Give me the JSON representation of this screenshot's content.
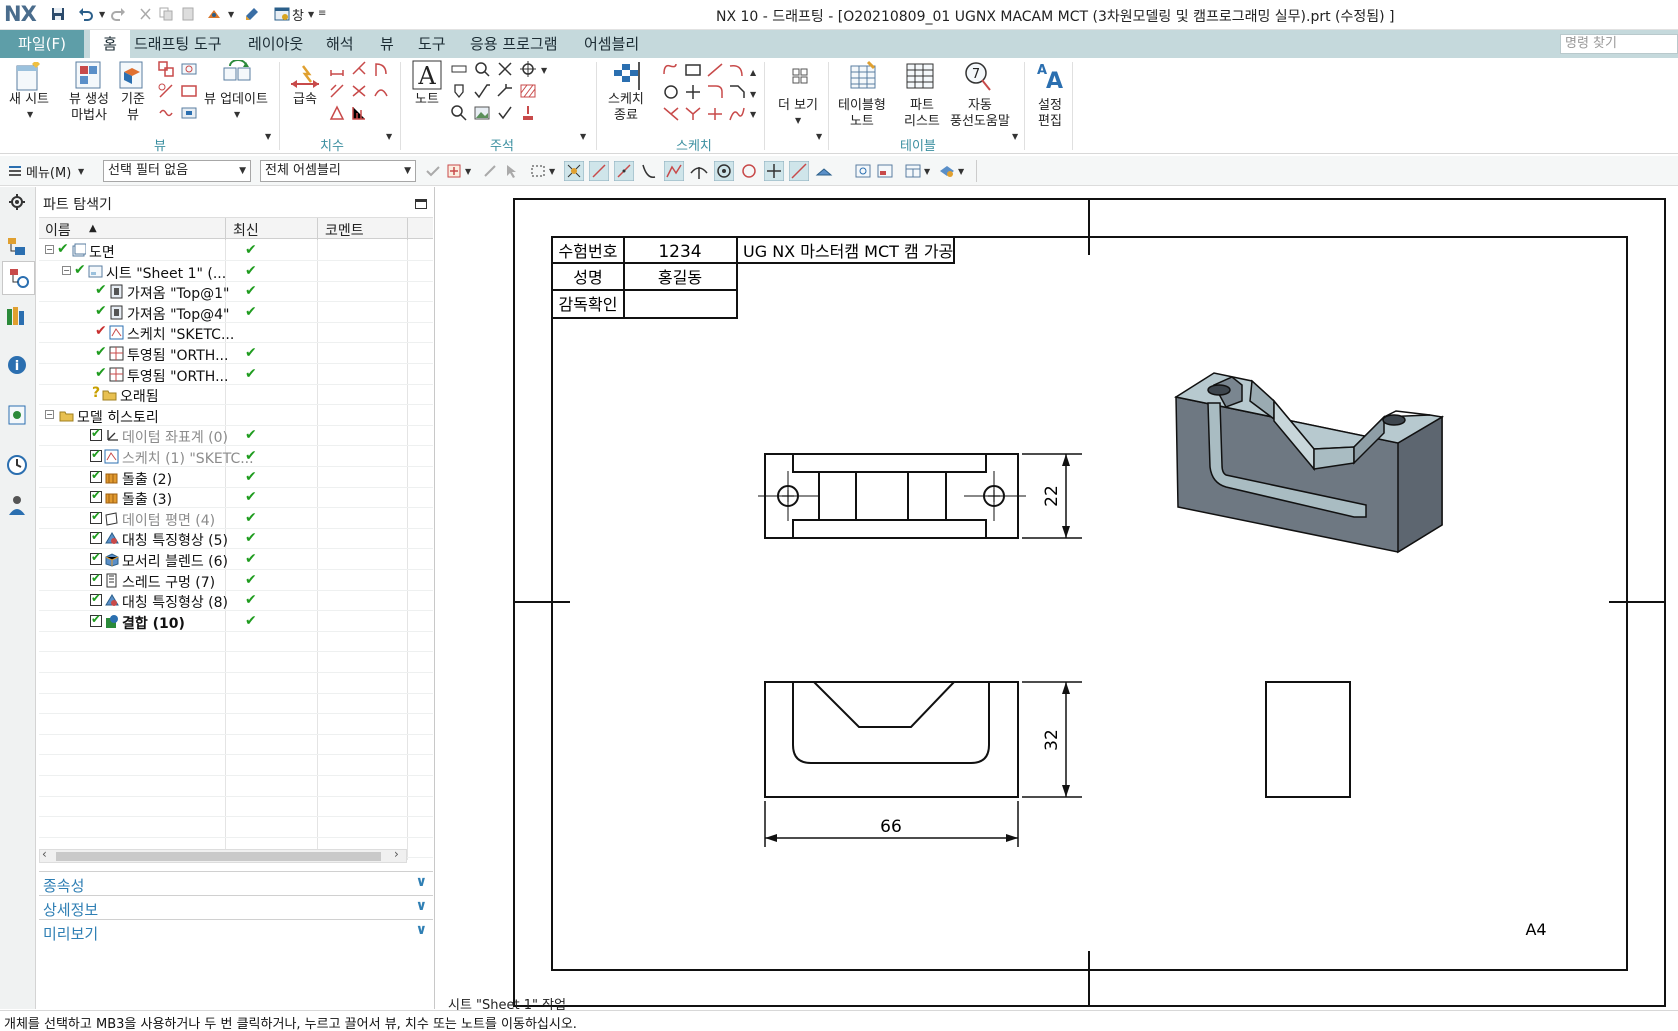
{
  "window": {
    "app_logo": "NX",
    "title": "NX 10 - 드래프팅 - [O20210809_01 UGNX MACAM MCT (3차원모델링 및 캠프로그래밍 실무).prt (수정됨) ]",
    "window_menu": "창"
  },
  "menu": {
    "file": "파일(F)",
    "tabs": [
      "홈",
      "드래프팅 도구",
      "레이아웃",
      "해석",
      "뷰",
      "도구",
      "응용 프로그램",
      "어셈블리"
    ],
    "command_search_placeholder": "명령 찾기"
  },
  "ribbon": {
    "new_sheet": "새 시트",
    "view_wizard_1": "뷰 생성",
    "view_wizard_2": "마법사",
    "base_view_1": "기준",
    "base_view_2": "뷰",
    "update_view": "뷰 업데이트",
    "rapid_dim": "급속",
    "note": "노트",
    "finish_sketch_1": "스케치",
    "finish_sketch_2": "종료",
    "more": "더 보기",
    "tabular_note_1": "테이블형",
    "tabular_note_2": "노트",
    "parts_list_1": "파트",
    "parts_list_2": "리스트",
    "auto_balloon_1": "자동",
    "auto_balloon_2": "풍선도움말",
    "edit_settings_1": "설정",
    "edit_settings_2": "편집",
    "groups": {
      "view": "뷰",
      "dimension": "치수",
      "annotation": "주석",
      "sketch": "스케치",
      "table": "테이블"
    }
  },
  "toolbar": {
    "menu": "메뉴(M)",
    "selection_filter": "선택 필터 없음",
    "assembly_scope": "전체 어셈블리"
  },
  "navigator": {
    "title": "파트 탐색기",
    "columns": [
      "이름",
      "최신",
      "코멘트"
    ],
    "rows": [
      {
        "name": "도면",
        "latest": true
      },
      {
        "name": "시트 \"Sheet 1\" (...",
        "latest": true
      },
      {
        "name": "가져옴 \"Top@1\"",
        "latest": true
      },
      {
        "name": "가져옴 \"Top@4\"",
        "latest": true
      },
      {
        "name": "스케치 \"SKETC...",
        "latest": false
      },
      {
        "name": "투영됨 \"ORTH...",
        "latest": true
      },
      {
        "name": "투영됨 \"ORTH...",
        "latest": true
      },
      {
        "name": "오래됨",
        "latest": false
      },
      {
        "name": "모델 히스토리",
        "latest": false
      },
      {
        "name": "데이텀 좌표계 (0)",
        "latest": true
      },
      {
        "name": "스케치 (1) \"SKETC...",
        "latest": true
      },
      {
        "name": "돌출 (2)",
        "latest": true
      },
      {
        "name": "돌출 (3)",
        "latest": true
      },
      {
        "name": "데이텀 평면 (4)",
        "latest": true
      },
      {
        "name": "대칭 특징형상 (5)",
        "latest": true
      },
      {
        "name": "모서리 블렌드 (6)",
        "latest": true
      },
      {
        "name": "스레드 구멍 (7)",
        "latest": true
      },
      {
        "name": "대칭 특징형상 (8)",
        "latest": true
      },
      {
        "name": "결합 (10)",
        "latest": true
      }
    ],
    "panels": [
      "종속성",
      "상세정보",
      "미리보기"
    ]
  },
  "drawing": {
    "title_block": {
      "exam_no_label": "수험번호",
      "exam_no": "1234",
      "drawing_title": "UG NX 마스터캠 MCT 캠 가공",
      "name_label": "성명",
      "name": "홍길동",
      "supervisor_label": "감독확인"
    },
    "dims": {
      "height_top": "22",
      "height_front": "32",
      "width": "66"
    },
    "sheet_size": "A4"
  },
  "status": {
    "sheet_work": "시트 \"Sheet 1\" 작업",
    "hint": "개체를 선택하고 MB3을 사용하거나 두 번 클릭하거나, 누르고 끌어서 뷰, 치수 또는 노트를 이동하십시오."
  },
  "colors": {
    "accent": "#5e9ea8",
    "menubar": "#c5d9dc",
    "check": "#1f9c1f",
    "link": "#2f7fb4",
    "model_dark": "#6c7680",
    "model_light": "#b4c6cc"
  }
}
